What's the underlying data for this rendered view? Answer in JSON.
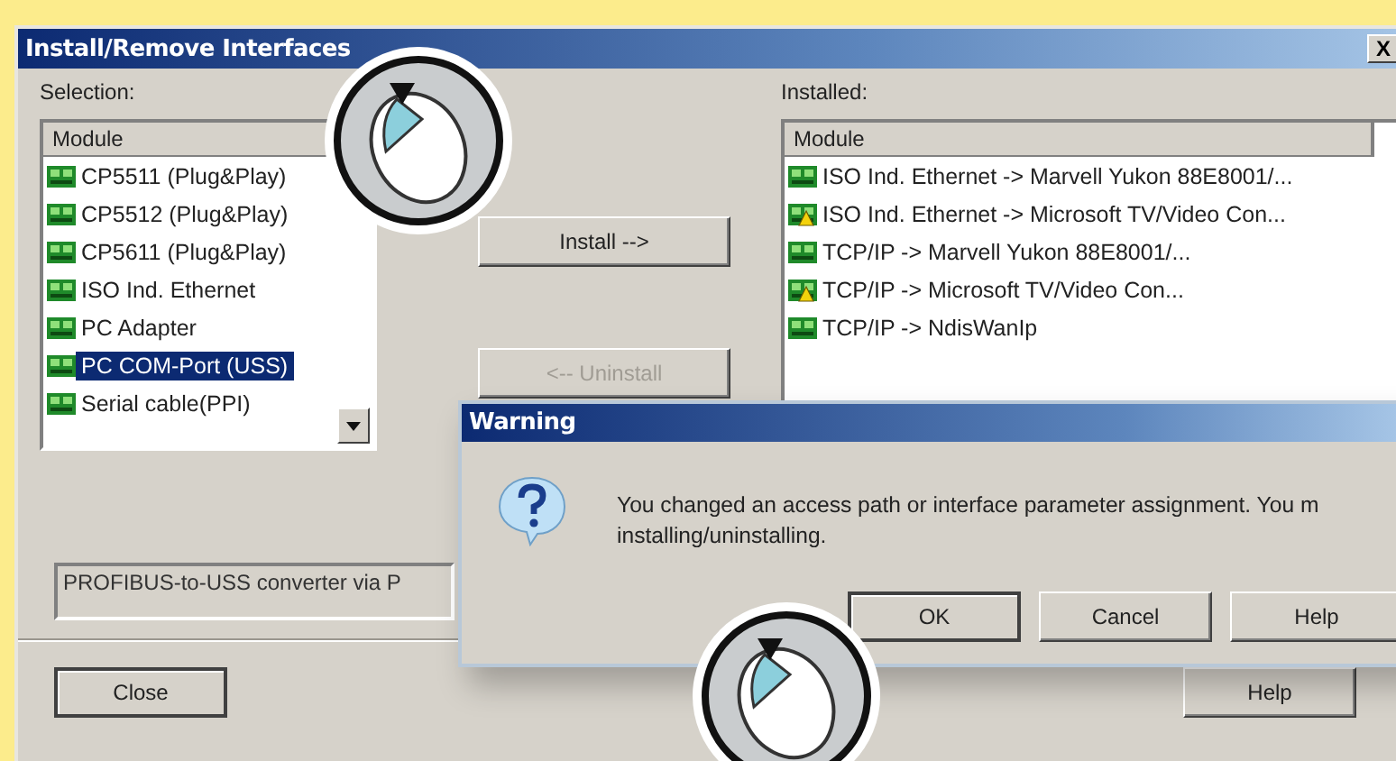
{
  "window": {
    "title": "Install/Remove Interfaces",
    "close_label": "X"
  },
  "selection": {
    "label": "Selection:",
    "column": "Module",
    "rows": [
      {
        "name": "CP5511 (Plug&Play)",
        "selected": false
      },
      {
        "name": "CP5512 (Plug&Play)",
        "selected": false
      },
      {
        "name": "CP5611 (Plug&Play)",
        "selected": false
      },
      {
        "name": "ISO Ind. Ethernet",
        "selected": false
      },
      {
        "name": "PC Adapter",
        "selected": false
      },
      {
        "name": "PC COM-Port (USS)",
        "selected": true
      },
      {
        "name": "Serial cable(PPI)",
        "selected": false
      }
    ]
  },
  "actions": [
    {
      "label": "Install -->",
      "disabled": false
    },
    {
      "label": "<-- Uninstall",
      "disabled": true
    }
  ],
  "installed": {
    "label": "Installed:",
    "column": "Module",
    "rows": [
      {
        "name": "ISO Ind. Ethernet -> Marvell Yukon 88E8001/...",
        "warning": false
      },
      {
        "name": "ISO Ind. Ethernet -> Microsoft TV/Video Con...",
        "warning": true
      },
      {
        "name": "TCP/IP -> Marvell Yukon 88E8001/...",
        "warning": false
      },
      {
        "name": "TCP/IP -> Microsoft TV/Video Con...",
        "warning": true
      },
      {
        "name": "TCP/IP -> NdisWanIp",
        "warning": false
      }
    ]
  },
  "description": "PROFIBUS-to-USS converter via P",
  "footer_buttons": [
    {
      "label": "Close",
      "default": true
    },
    {
      "label": "Help",
      "default": false
    }
  ],
  "warning_dialog": {
    "title": "Warning",
    "message": "You changed an access path or interface parameter assignment. You m\ninstalling/uninstalling.",
    "buttons": [
      {
        "label": "OK",
        "default": true
      },
      {
        "label": "Cancel",
        "default": false
      },
      {
        "label": "Help",
        "default": false
      }
    ]
  }
}
